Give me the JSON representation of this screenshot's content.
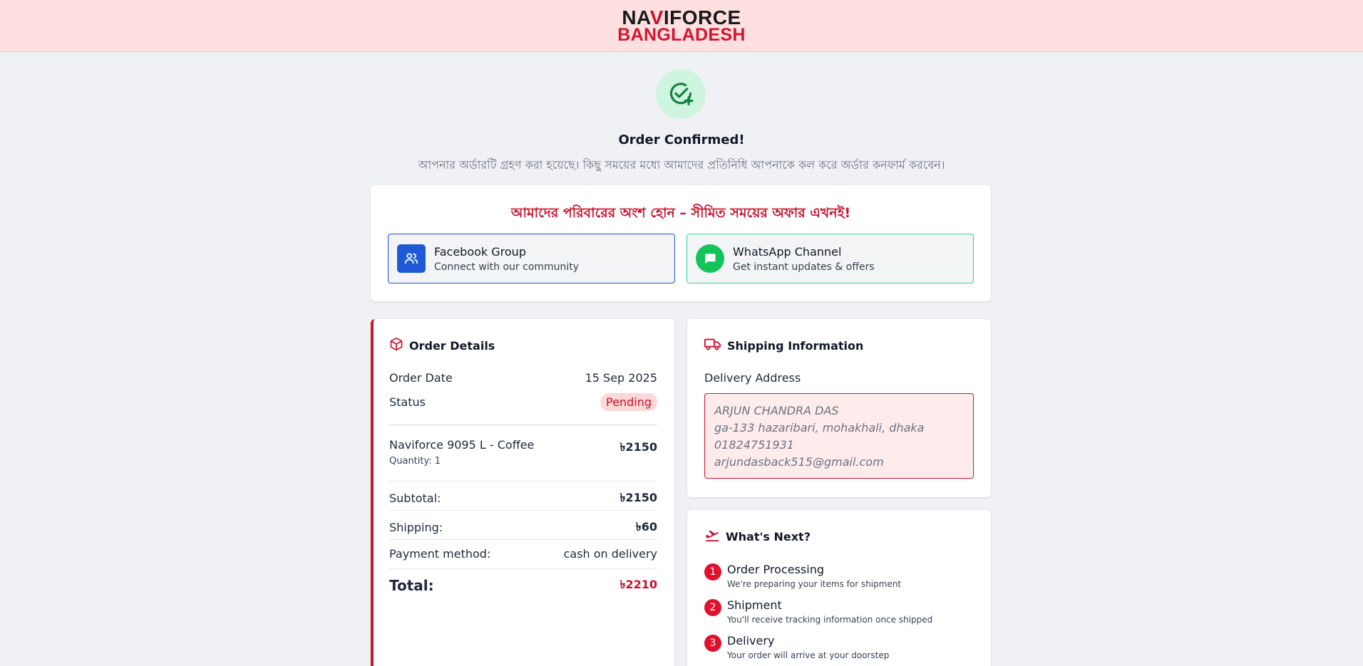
{
  "header": {
    "logo_line1_a": "NA",
    "logo_line1_b": "V",
    "logo_line1_c": "IFORCE",
    "logo_line2": "BANGLADESH"
  },
  "confirmation": {
    "title": "Order Confirmed!",
    "subtitle": "আপনার অর্ডারটি গ্রহণ করা হয়েছে। কিছু সময়ের মধ্যে আমাদের প্রতিনিধি আপনাকে কল করে অর্ডার কনফার্ম করবেন।"
  },
  "promo": {
    "heading": "আমাদের পরিবারের অংশ হোন – সীমিত সময়ের অফার এখনই!",
    "facebook": {
      "title": "Facebook Group",
      "subtitle": "Connect with our community"
    },
    "whatsapp": {
      "title": "WhatsApp Channel",
      "subtitle": "Get instant updates & offers"
    }
  },
  "order": {
    "title": "Order Details",
    "date_label": "Order Date",
    "date_value": "15 Sep 2025",
    "status_label": "Status",
    "status_value": "Pending",
    "item_name": "Naviforce 9095 L - Coffee",
    "item_qty": "Quantity: 1",
    "item_price": "৳2150",
    "subtotal_label": "Subtotal:",
    "subtotal_value": "৳2150",
    "shipping_label": "Shipping:",
    "shipping_value": "৳60",
    "payment_label": "Payment method:",
    "payment_value": "cash on delivery",
    "total_label": "Total:",
    "total_value": "৳2210"
  },
  "shipping": {
    "title": "Shipping Information",
    "address_label": "Delivery Address",
    "name": "ARJUN CHANDRA DAS",
    "address": "ga-133 hazaribari, mohakhali, dhaka",
    "phone": "01824751931",
    "email": "arjundasback515@gmail.com"
  },
  "next": {
    "title": "What's Next?",
    "steps": [
      {
        "num": "1",
        "title": "Order Processing",
        "desc": "We're preparing your items for shipment"
      },
      {
        "num": "2",
        "title": "Shipment",
        "desc": "You'll receive tracking information once shipped"
      },
      {
        "num": "3",
        "title": "Delivery",
        "desc": "Your order will arrive at your doorstep"
      }
    ]
  },
  "colors": {
    "brand_red": "#c8102e",
    "header_bg": "#fde0df",
    "success_green": "#16a34a",
    "facebook_blue": "#1e5ad6",
    "whatsapp_green": "#16c35a"
  },
  "icons": {
    "check": "check-circle-plus-icon",
    "facebook": "users-icon",
    "whatsapp": "chat-icon",
    "order": "package-icon",
    "shipping": "truck-icon",
    "next": "plane-icon"
  }
}
